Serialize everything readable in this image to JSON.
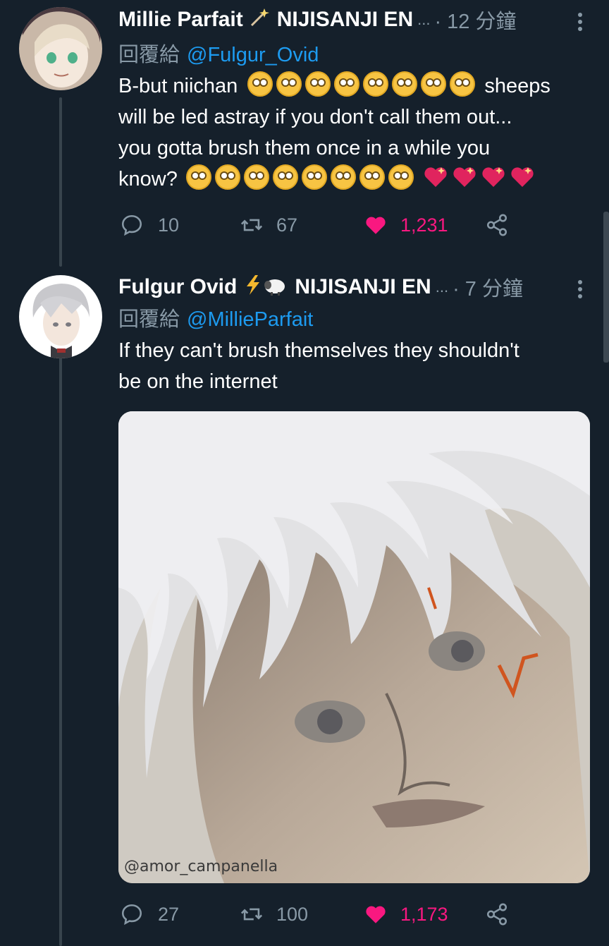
{
  "tweets": [
    {
      "name": "Millie Parfait",
      "name_icon": "magic-wand-icon",
      "affiliation": "NIJISANJI EN",
      "ellipsis": "...",
      "time": "· 12 分鐘",
      "reply_prefix": "回覆給",
      "reply_handle": "@Fulgur_Ovid",
      "text_line1_a": "B-but niichan",
      "text_line1_b": "sheeps",
      "text_line2": "will be led astray if you don't call them out...",
      "text_line3": "you gotta brush them once in a while you",
      "text_line4_a": "know?",
      "reply_count": "10",
      "retweet_count": "67",
      "like_count": "1,231"
    },
    {
      "name": "Fulgur Ovid",
      "name_icon": "lightning-sheep-icon",
      "affiliation": "NIJISANJI EN",
      "ellipsis": "...",
      "time": "· 7 分鐘",
      "reply_prefix": "回覆給",
      "reply_handle": "@MillieParfait",
      "text_line1": "If they can't brush themselves they shouldn't",
      "text_line2": "be on the internet",
      "media_signature": "@amor_campanella",
      "reply_count": "27",
      "retweet_count": "100",
      "like_count": "1,173"
    }
  ],
  "colors": {
    "background": "#15202b",
    "secondary_text": "#8899a6",
    "link": "#1d9bf0",
    "like": "#f91880"
  }
}
